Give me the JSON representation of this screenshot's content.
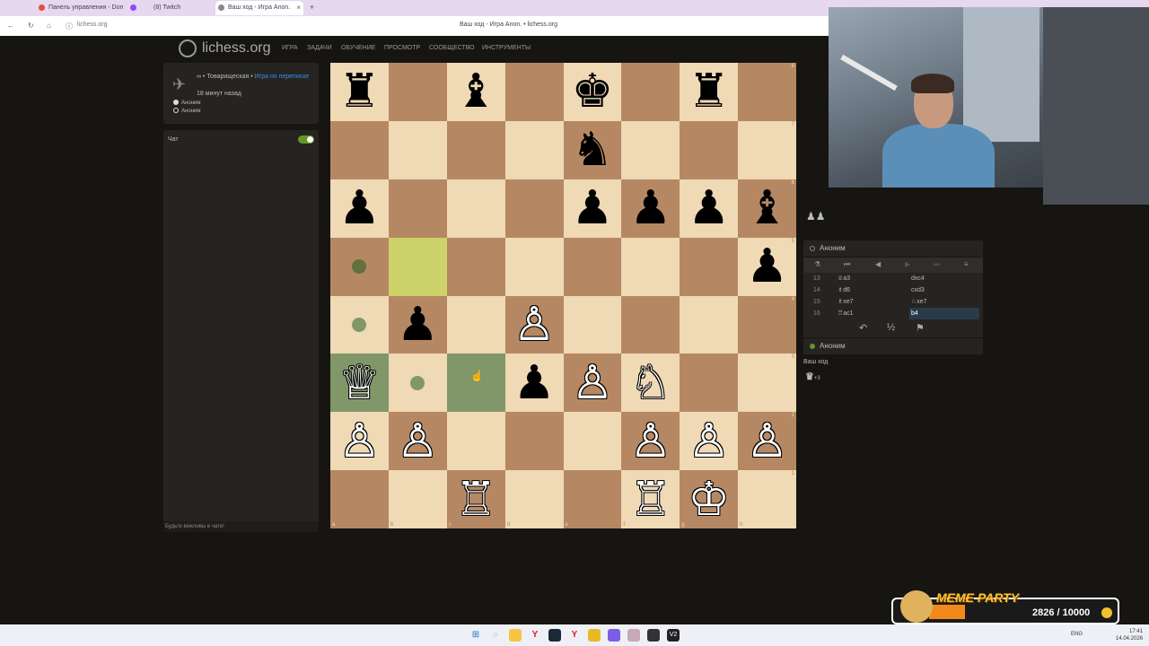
{
  "browser": {
    "tabs": [
      {
        "label": "Панель управления - Don",
        "color": "#e74c3c"
      },
      {
        "label": "(8) Twitch",
        "color": "#9146ff"
      },
      {
        "label": "Ваш ход - Игра Anon.",
        "color": "#555555"
      }
    ],
    "window_title": "Ваш ход - Игра Anon. • lichess.org",
    "url": "lichess.org"
  },
  "site": {
    "logo_text": "lichess.org",
    "menu": [
      "ИГРА",
      "ЗАДАЧИ",
      "ОБУЧЕНИЕ",
      "ПРОСМОТР",
      "СООБЩЕСТВО",
      "ИНСТРУМЕНТЫ"
    ]
  },
  "game_info": {
    "mode": "∞ • Товарищеская •",
    "link": "Игра по переписке",
    "time_ago": "18 минут назад",
    "players": [
      "Аноним",
      "Аноним"
    ]
  },
  "chat": {
    "title": "Чат",
    "placeholder": "Будьте вежливы в чате!"
  },
  "board": {
    "ranks": [
      [
        "b:♜",
        "",
        "b:♝",
        "",
        "b:♚",
        "",
        "b:♜",
        ""
      ],
      [
        "",
        "",
        "",
        "",
        "b:♞",
        "",
        "",
        ""
      ],
      [
        "b:♟",
        "",
        "",
        "",
        "b:♟",
        "b:♟",
        "b:♟",
        "b:♝"
      ],
      [
        "dot",
        "hl",
        "",
        "",
        "",
        "",
        "",
        "b:♟"
      ],
      [
        "dot",
        "b:♟",
        "",
        "w:♙",
        "",
        "",
        "",
        ""
      ],
      [
        "w:♕",
        "dot",
        "sel",
        "b:♟",
        "w:♙",
        "w:♘",
        "",
        ""
      ],
      [
        "w:♙",
        "w:♙",
        "",
        "",
        "",
        "w:♙",
        "w:♙",
        "w:♙"
      ],
      [
        "",
        "",
        "w:♖",
        "",
        "",
        "w:♖",
        "w:♔",
        ""
      ]
    ],
    "rank_labels": [
      "8",
      "7",
      "6",
      "5",
      "4",
      "3",
      "2",
      "1"
    ],
    "file_labels": [
      "a",
      "b",
      "c",
      "d",
      "e",
      "f",
      "g",
      "h"
    ]
  },
  "side_panel": {
    "captured_top": "♟♟",
    "opponent": "Аноним",
    "moves": [
      {
        "n": "13",
        "w": "♕a3",
        "b": "dxc4"
      },
      {
        "n": "14",
        "w": "♗d6",
        "b": "cxd3"
      },
      {
        "n": "15",
        "w": "♗xe7",
        "b": "♘xe7"
      },
      {
        "n": "16",
        "w": "♖ac1",
        "b": "b4"
      }
    ],
    "me": "Аноним",
    "your_turn": "Ваш ход",
    "material_icon": "♛",
    "material_diff": "+3"
  },
  "overlay": {
    "title": "MEME PARTY",
    "count": "2826 / 10000"
  },
  "taskbar": {
    "lang": "ENG",
    "time": "17:41",
    "date": "14.04.2026"
  }
}
